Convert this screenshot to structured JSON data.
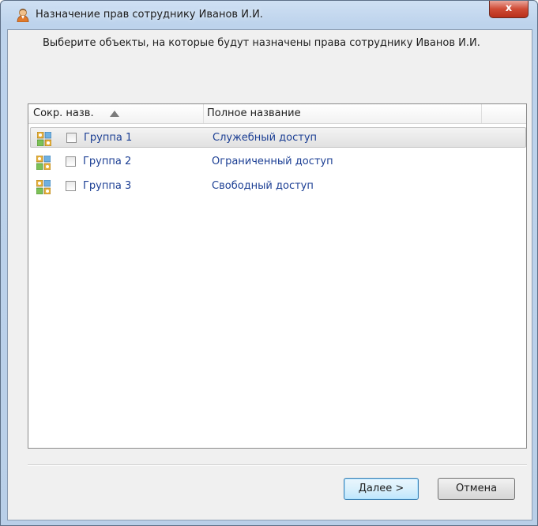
{
  "window": {
    "title": "Назначение прав сотруднику Иванов И.И.",
    "close_glyph": "x",
    "icon": "user-icon"
  },
  "instruction": "Выберите объекты, на которые будут назначены права сотруднику Иванов И.И.",
  "list": {
    "columns": [
      "Сокр. назв.",
      "Полное название"
    ],
    "sort_indicator": "ascending",
    "rows": [
      {
        "short": "Группа 1",
        "full": "Служебный доступ",
        "checked": false,
        "selected": true,
        "icon": "group-icon"
      },
      {
        "short": "Группа 2",
        "full": "Ограниченный доступ",
        "checked": false,
        "selected": false,
        "icon": "group-icon"
      },
      {
        "short": "Группа 3",
        "full": "Свободный доступ",
        "checked": false,
        "selected": false,
        "icon": "group-icon"
      }
    ]
  },
  "buttons": {
    "next": "Далее >",
    "cancel": "Отмена"
  },
  "colors": {
    "link_text": "#1c3f94",
    "frame": "#bdd3ec",
    "close_button": "#cf4b35",
    "default_button": "#bee6fd"
  }
}
